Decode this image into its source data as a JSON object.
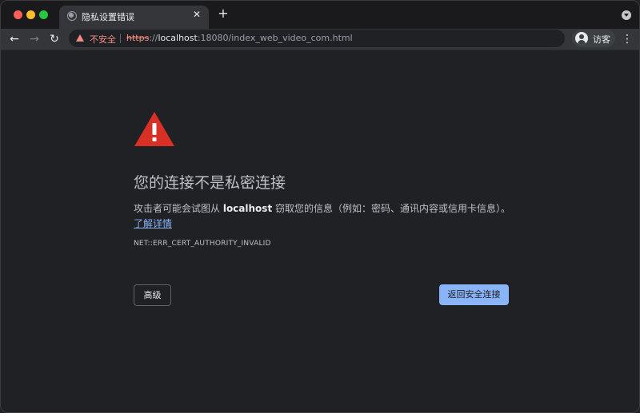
{
  "window": {
    "controls": [
      "close",
      "minimize",
      "maximize"
    ],
    "colors": {
      "close": "#fe5f57",
      "minimize": "#febc2e",
      "maximize": "#28c840"
    }
  },
  "tab": {
    "title": "隐私设置错误",
    "favicon": "globe-icon",
    "close_glyph": "✕"
  },
  "tabstrip": {
    "new_tab_glyph": "+"
  },
  "toolbar": {
    "back_glyph": "←",
    "forward_glyph": "→",
    "reload_glyph": "↻",
    "menu_glyph": "⋮"
  },
  "omnibox": {
    "security_label": "不安全",
    "url_scheme": "https",
    "url_separator": "://",
    "url_host": "localhost",
    "url_rest": ":18080/index_web_video_com.html"
  },
  "profile": {
    "label": "访客",
    "icon": "avatar-icon"
  },
  "interstitial": {
    "heading": "您的连接不是私密连接",
    "explanation_before": "攻击者可能会试图从 ",
    "explanation_host": "localhost",
    "explanation_after": " 窃取您的信息（例如：密码、通讯内容或信用卡信息）。",
    "learn_more": "了解详情",
    "error_code": "NET::ERR_CERT_AUTHORITY_INVALID",
    "advanced_button": "高级",
    "back_button": "返回安全连接"
  },
  "colors": {
    "background": "#202124",
    "warning_red": "#d93025",
    "insecure_red": "#f28b82",
    "accent_blue": "#8ab4f8"
  }
}
